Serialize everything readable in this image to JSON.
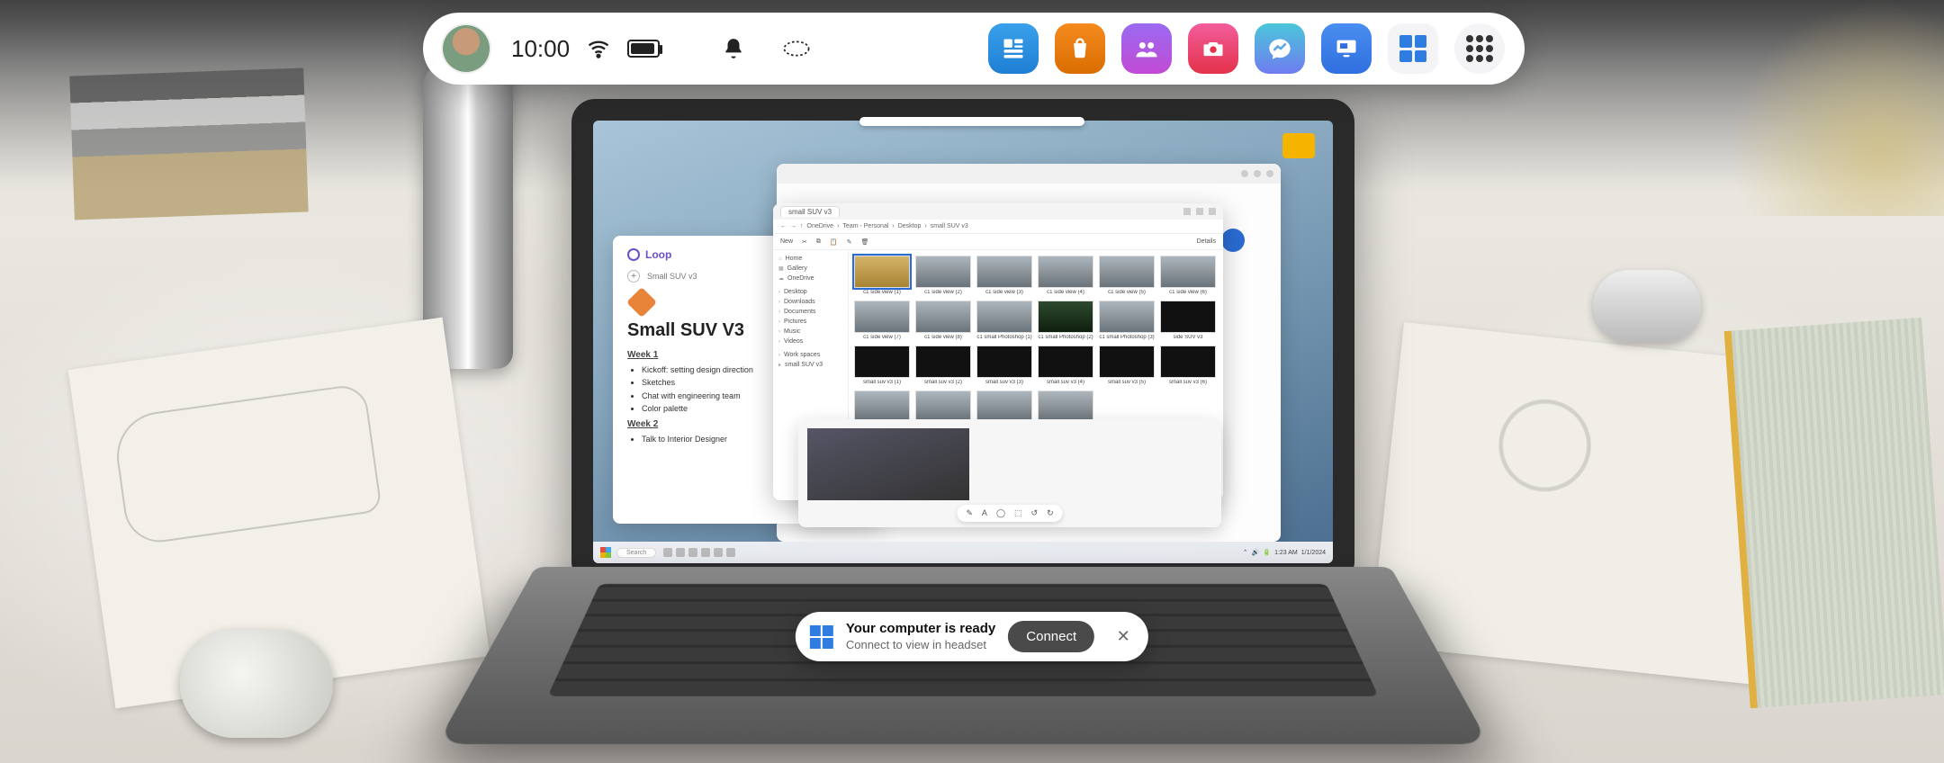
{
  "topbar": {
    "time": "10:00",
    "apps": {
      "feed": "feed",
      "store": "store",
      "people": "people",
      "camera": "camera",
      "messenger": "messenger",
      "remote_desktop": "remote-desktop",
      "windows": "windows",
      "all_apps": "all-apps"
    }
  },
  "toast": {
    "title": "Your computer is ready",
    "subtitle": "Connect to view in headset",
    "button": "Connect"
  },
  "laptop": {
    "taskbar": {
      "search_placeholder": "Search",
      "time": "1:23 AM",
      "date": "1/1/2024"
    },
    "loop": {
      "brand": "Loop",
      "tab": "Small SUV v3",
      "title": "Small SUV V3",
      "week1": "Week 1",
      "week2": "Week 2",
      "items1": [
        "Kickoff: setting design direction",
        "Sketches",
        "Chat with engineering team",
        "Color palette"
      ],
      "items2": [
        "Talk to Interior Designer"
      ]
    },
    "explorer": {
      "tab": "small SUV v3",
      "crumbs": [
        "OneDrive",
        "Team - Personal",
        "Desktop",
        "small SUV v3"
      ],
      "toolbar_new": "New",
      "toolbar_details": "Details",
      "side": [
        "Home",
        "Gallery",
        "OneDrive",
        "Desktop",
        "Downloads",
        "Documents",
        "Pictures",
        "Music",
        "Videos",
        "Work spaces",
        "small SUV v3"
      ],
      "files_row1": [
        "c1 side view (1)",
        "c1 side view (2)",
        "c1 side view (3)",
        "c1 side view (4)",
        "c1 side view (5)",
        "c1 side view (6)"
      ],
      "files_row2": [
        "c1 side view (7)",
        "c1 side view (8)",
        "c1 small Photoshop (1)",
        "c1 small Photoshop (2)",
        "c1 small Photoshop (3)",
        "side SUV v3"
      ],
      "files_row3": [
        "small suv v3 (1)",
        "small suv v3 (2)",
        "small suv v3 (3)",
        "small suv v3 (4)",
        "small suv v3 (5)",
        "small suv v3 (6)"
      ]
    }
  }
}
